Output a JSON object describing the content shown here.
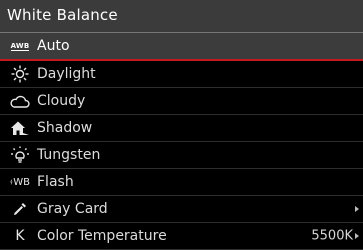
{
  "header": {
    "title": "White Balance"
  },
  "items": [
    {
      "label": "Auto",
      "icon": "awb-icon",
      "icon_text": "AWB",
      "selected": true
    },
    {
      "label": "Daylight",
      "icon": "sun-icon"
    },
    {
      "label": "Cloudy",
      "icon": "cloud-icon"
    },
    {
      "label": "Shadow",
      "icon": "house-shadow-icon"
    },
    {
      "label": "Tungsten",
      "icon": "bulb-icon"
    },
    {
      "label": "Flash",
      "icon": "flash-icon",
      "icon_text": "WB"
    },
    {
      "label": "Gray Card",
      "icon": "eyedropper-icon",
      "has_arrow": true
    },
    {
      "label": "Color Temperature",
      "icon": "kelvin-icon",
      "icon_text": "K",
      "value": "5500K",
      "has_arrow": true
    }
  ],
  "colors": {
    "header_bg": "#3b3b3b",
    "selection_accent": "#c41a20",
    "background": "#000000"
  }
}
